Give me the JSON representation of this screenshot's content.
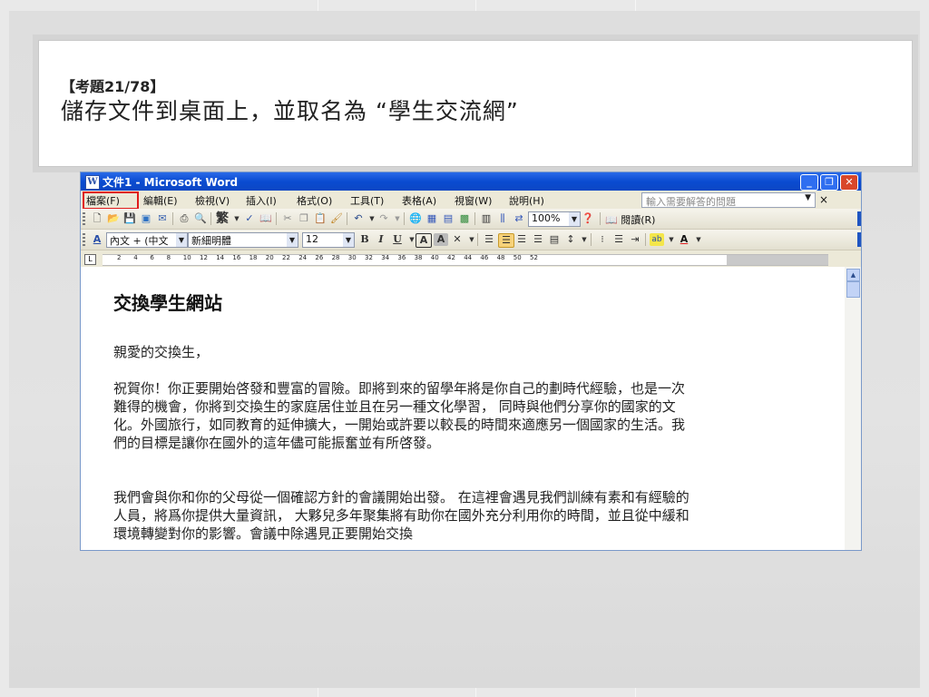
{
  "slide": {
    "question_label": "【考題21/78】",
    "question_text": "儲存文件到桌面上，並取名為 “學生交流網”"
  },
  "window": {
    "title": "文件1 - Microsoft Word",
    "min_symbol": "_",
    "max_symbol": "❐",
    "close_symbol": "✕"
  },
  "menubar": {
    "items": [
      "檔案(F)",
      "編輯(E)",
      "檢視(V)",
      "插入(I)",
      "格式(O)",
      "工具(T)",
      "表格(A)",
      "視窗(W)",
      "說明(H)"
    ],
    "help_placeholder": "輸入需要解答的問題",
    "close_symbol": "×"
  },
  "toolbar_standard": {
    "trad_label": "繁",
    "zoom": "100%",
    "read_label": "閱讀(R)"
  },
  "toolbar_format": {
    "style": "內文 + (中文",
    "font": "新細明體",
    "size": "12",
    "bold": "B",
    "italic": "I",
    "underline": "U"
  },
  "ruler": {
    "marks": [
      "2",
      "4",
      "6",
      "8",
      "10",
      "12",
      "14",
      "16",
      "18",
      "20",
      "22",
      "24",
      "26",
      "28",
      "30",
      "32",
      "34",
      "36",
      "38",
      "40",
      "42",
      "44",
      "46",
      "48",
      "50",
      "52"
    ]
  },
  "document": {
    "title": "交換學生網站",
    "greeting": "親愛的交換生，",
    "para1": "祝賀你！你正要開始啓發和豐富的冒險。即將到來的留學年將是你自己的劃時代經驗，也是一次難得的機會，你將到交換生的家庭居住並且在另一種文化學習， 同時與他們分享你的國家的文化。外國旅行，如同教育的延伸擴大，一開始或許要以較長的時間來適應另一個國家的生活。我們的目標是讓你在國外的這年儘可能振奮並有所啓發。",
    "para2": "我們會與你和你的父母從一個確認方針的會議開始出發。 在這裡會遇見我們訓練有素和有經驗的人員，將爲你提供大量資訊， 大夥兒多年聚集將有助你在國外充分利用你的時間，並且從中緩和環境轉變對你的影響。會議中除遇見正要開始交換"
  }
}
